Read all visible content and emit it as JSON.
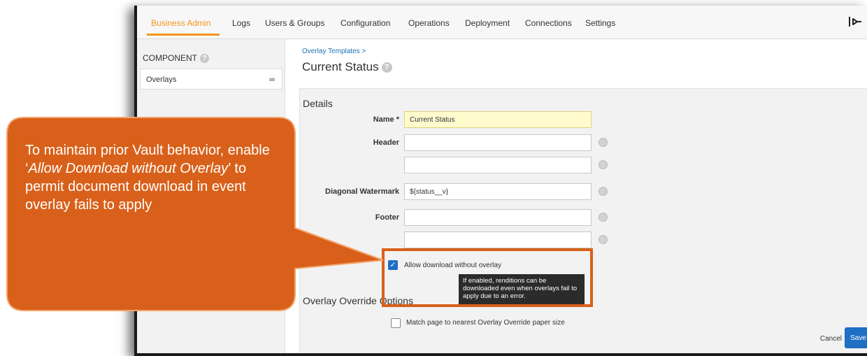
{
  "nav": {
    "items": [
      "Business Admin",
      "Logs",
      "Users & Groups",
      "Configuration",
      "Operations",
      "Deployment",
      "Connections",
      "Settings"
    ],
    "active": "Business Admin",
    "logout_icon": "logout-icon"
  },
  "sidebar": {
    "title": "COMPONENT",
    "selected_item": "Overlays",
    "item_icon": "binoculars-icon"
  },
  "header": {
    "breadcrumb": "Overlay Templates >",
    "title": "Current Status"
  },
  "details": {
    "title": "Details",
    "name_label": "Name *",
    "name_value": "Current Status",
    "header_label": "Header",
    "header_value_1": "",
    "header_value_2": "",
    "watermark_label": "Diagonal Watermark",
    "watermark_value": "${status__v}",
    "footer_label": "Footer",
    "footer_value_1": "",
    "footer_value_2": "",
    "allow_download_label": "Allow download without overlay",
    "allow_download_checked": true,
    "tooltip_text": "If enabled, renditions can be downloaded even when overlays fail to apply due to an error."
  },
  "override": {
    "title": "Overlay Override Options",
    "match_label": "Match page to nearest Overlay Override paper size",
    "match_checked": false
  },
  "actions": {
    "cancel": "Cancel",
    "save": "Save"
  },
  "callout": {
    "text_1": "To maintain prior Vault behavior, enable ‘",
    "text_em": "Allow Download without Overlay",
    "text_2": "’ to permit document download in event overlay fails to apply"
  },
  "colors": {
    "accent": "#f7941d",
    "callout": "#d9601a",
    "primary": "#1f6fc5"
  }
}
